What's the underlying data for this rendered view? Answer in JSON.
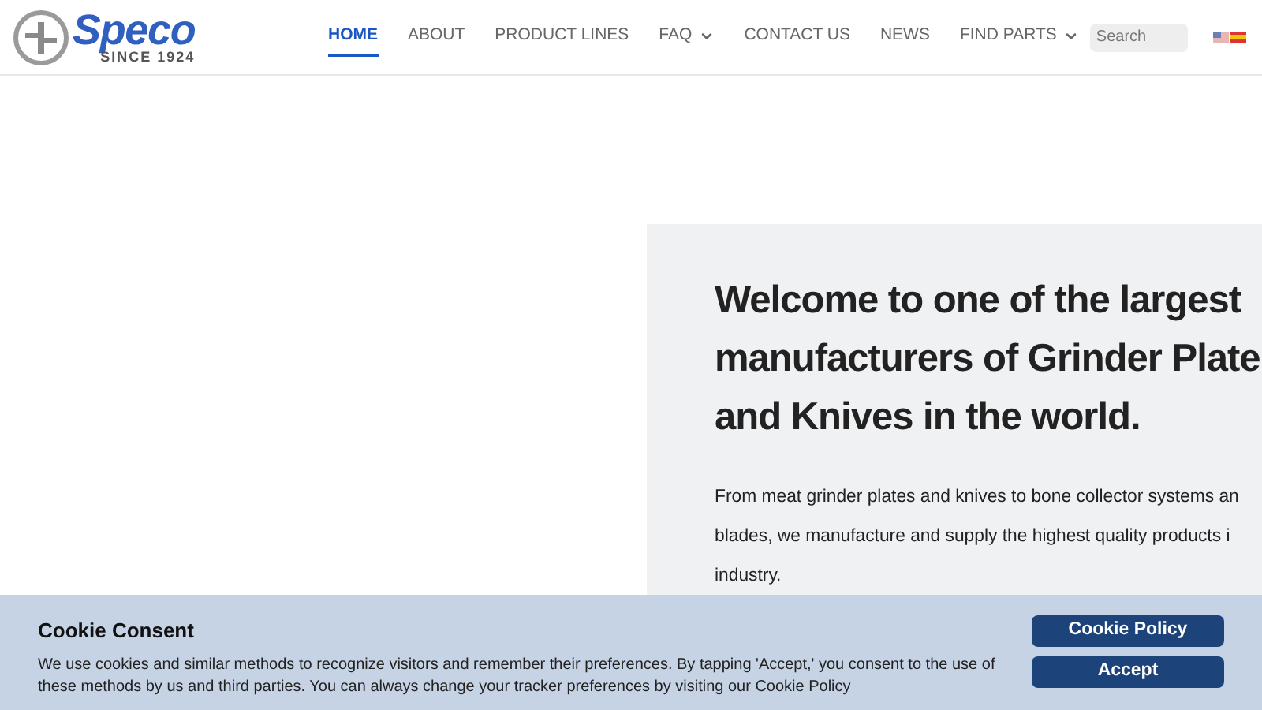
{
  "logo": {
    "name": "Speco",
    "tagline": "SINCE 1924"
  },
  "nav": [
    {
      "label": "HOME",
      "selected": true,
      "has_menu": false
    },
    {
      "label": "ABOUT",
      "selected": false,
      "has_menu": false
    },
    {
      "label": "PRODUCT LINES",
      "selected": false,
      "has_menu": false
    },
    {
      "label": "FAQ",
      "selected": false,
      "has_menu": true
    },
    {
      "label": "CONTACT US",
      "selected": false,
      "has_menu": false
    },
    {
      "label": "NEWS",
      "selected": false,
      "has_menu": false
    },
    {
      "label": "FIND PARTS",
      "selected": false,
      "has_menu": true
    }
  ],
  "search": {
    "placeholder": "Search"
  },
  "hero": {
    "heading_lines": [
      "Welcome to one of the largest",
      "manufacturers of Grinder Plate",
      "and Knives in the world."
    ],
    "paragraph_lines": [
      "From meat grinder plates and knives to bone collector systems an",
      "blades, we manufacture and supply the highest quality products i",
      "industry."
    ]
  },
  "cookie": {
    "title": "Cookie Consent",
    "text": "We use cookies and similar methods to recognize visitors and remember their preferences. By tapping 'Accept,' you consent to the use of these methods by us and third parties. You can always change your tracker preferences by visiting our Cookie Policy",
    "buttons": [
      "Cookie Policy",
      "Accept"
    ]
  }
}
